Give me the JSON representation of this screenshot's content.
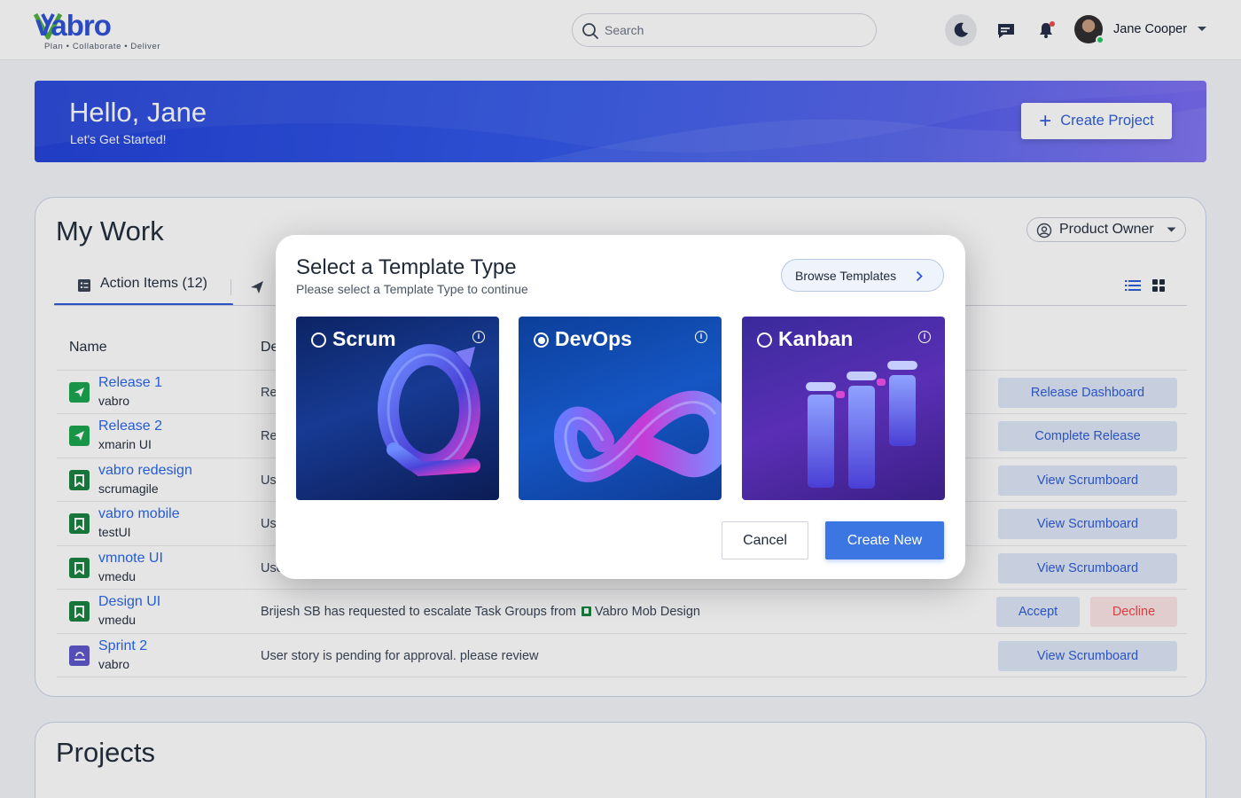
{
  "brand": {
    "name": "vabro",
    "tagline": "Plan • Collaborate • Deliver"
  },
  "header": {
    "search_placeholder": "Search",
    "user_name": "Jane Cooper",
    "icons": [
      "search-icon",
      "moon-icon",
      "message-icon",
      "bell-icon",
      "chevron-down-icon"
    ]
  },
  "hero": {
    "greeting": "Hello, Jane",
    "subtitle": "Let's Get Started!",
    "create_project_label": "Create Project"
  },
  "my_work": {
    "title": "My Work",
    "role": "Product Owner",
    "active_tab": "Action Items (12)",
    "columns": {
      "name": "Name",
      "description": "De"
    },
    "rows": [
      {
        "title": "Release 1",
        "subtitle": "vabro",
        "desc": "Re",
        "type": "release",
        "actions": [
          "Release Dashboard"
        ]
      },
      {
        "title": "Release 2",
        "subtitle": "xmarin UI",
        "desc": "Re",
        "type": "release",
        "actions": [
          "Complete Release"
        ]
      },
      {
        "title": "vabro redesign",
        "subtitle": "scrumagile",
        "desc": "Us",
        "type": "board",
        "actions": [
          "View Scrumboard"
        ]
      },
      {
        "title": "vabro mobile",
        "subtitle": "testUI",
        "desc": "Us",
        "type": "board",
        "actions": [
          "View Scrumboard"
        ]
      },
      {
        "title": "vmnote UI",
        "subtitle": "vmedu",
        "desc": "Use",
        "type": "board",
        "actions": [
          "View Scrumboard"
        ]
      },
      {
        "title": "Design UI",
        "subtitle": "vmedu",
        "desc": "Brijesh SB has requested to escalate Task Groups from",
        "desc_link": "Vabro Mob Design",
        "type": "board",
        "actions": [
          "Accept",
          "Decline"
        ]
      },
      {
        "title": "Sprint 2",
        "subtitle": "vabro",
        "desc": "User story is pending for approval. please review",
        "type": "sprint",
        "actions": [
          "View Scrumboard"
        ]
      }
    ]
  },
  "projects": {
    "title": "Projects"
  },
  "modal": {
    "title": "Select a Template Type",
    "subtitle": "Please select a Template Type to continue",
    "browse_label": "Browse Templates",
    "templates": [
      {
        "name": "Scrum",
        "selected": false
      },
      {
        "name": "DevOps",
        "selected": true
      },
      {
        "name": "Kanban",
        "selected": false
      }
    ],
    "info_glyph": "i",
    "cancel_label": "Cancel",
    "create_label": "Create New"
  },
  "colors": {
    "primary": "#2b59d9",
    "button_blue": "#3b76e2",
    "decline_red": "#ef4444",
    "release_green": "#16a34a"
  }
}
